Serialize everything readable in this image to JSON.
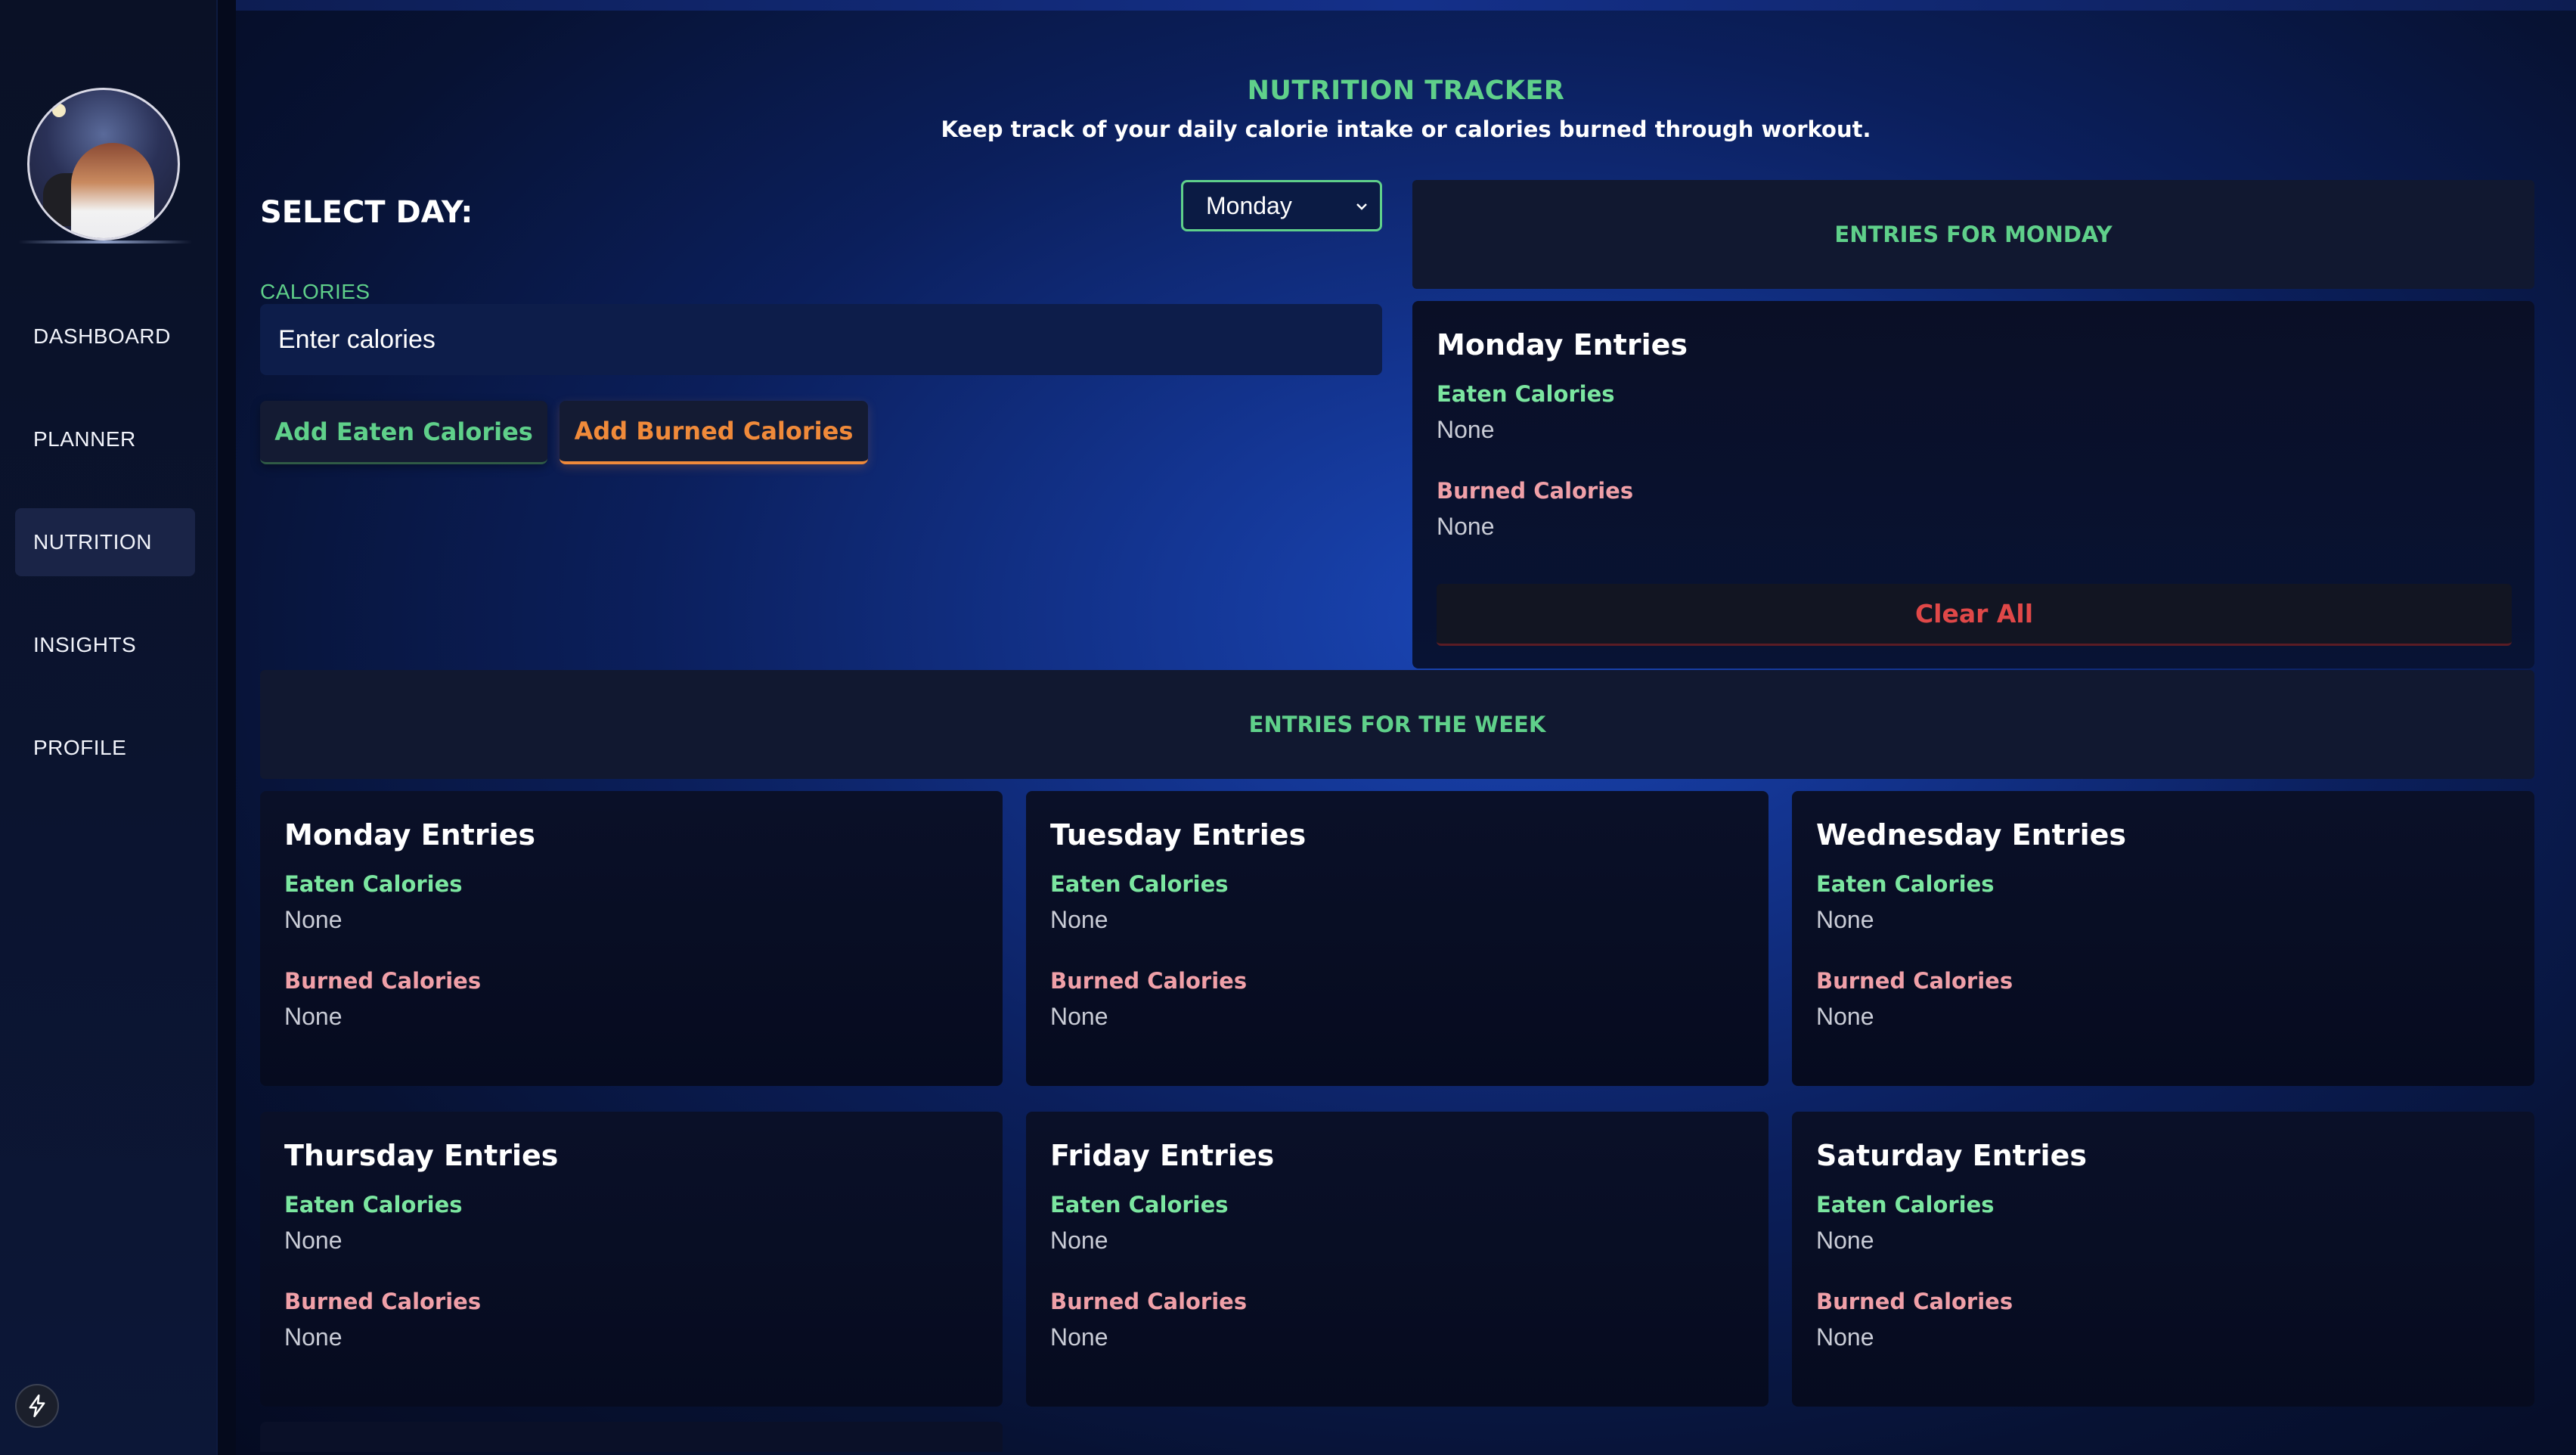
{
  "sidebar": {
    "items": [
      {
        "label": "DASHBOARD"
      },
      {
        "label": "PLANNER"
      },
      {
        "label": "NUTRITION"
      },
      {
        "label": "INSIGHTS"
      },
      {
        "label": "PROFILE"
      }
    ],
    "active": "NUTRITION"
  },
  "header": {
    "title": "NUTRITION TRACKER",
    "subtitle": "Keep track of your daily calorie intake or calories burned through workout."
  },
  "form": {
    "select_label": "SELECT DAY:",
    "selected_day": "Monday",
    "calories_label": "CALORIES",
    "calories_placeholder": "Enter calories",
    "add_eaten_label": "Add Eaten Calories",
    "add_burned_label": "Add Burned Calories"
  },
  "selected_panel": {
    "heading": "ENTRIES FOR MONDAY",
    "card": {
      "title": "Monday Entries",
      "eaten_label": "Eaten Calories",
      "eaten_value": "None",
      "burned_label": "Burned Calories",
      "burned_value": "None"
    },
    "clear_label": "Clear All"
  },
  "week": {
    "heading": "ENTRIES FOR THE WEEK",
    "cards": [
      {
        "title": "Monday Entries",
        "eaten_label": "Eaten Calories",
        "eaten_value": "None",
        "burned_label": "Burned Calories",
        "burned_value": "None"
      },
      {
        "title": "Tuesday Entries",
        "eaten_label": "Eaten Calories",
        "eaten_value": "None",
        "burned_label": "Burned Calories",
        "burned_value": "None"
      },
      {
        "title": "Wednesday Entries",
        "eaten_label": "Eaten Calories",
        "eaten_value": "None",
        "burned_label": "Burned Calories",
        "burned_value": "None"
      },
      {
        "title": "Thursday Entries",
        "eaten_label": "Eaten Calories",
        "eaten_value": "None",
        "burned_label": "Burned Calories",
        "burned_value": "None"
      },
      {
        "title": "Friday Entries",
        "eaten_label": "Eaten Calories",
        "eaten_value": "None",
        "burned_label": "Burned Calories",
        "burned_value": "None"
      },
      {
        "title": "Saturday Entries",
        "eaten_label": "Eaten Calories",
        "eaten_value": "None",
        "burned_label": "Burned Calories",
        "burned_value": "None"
      }
    ]
  },
  "colors": {
    "accent_green": "#5fd08a",
    "burned_orange": "#f08a3a",
    "burned_pink": "#f0a0a8",
    "danger_red": "#e04848"
  },
  "icons": {
    "avatar": "profile-avatar",
    "bolt": "lightning-bolt-icon",
    "chevron": "chevron-down-icon"
  }
}
